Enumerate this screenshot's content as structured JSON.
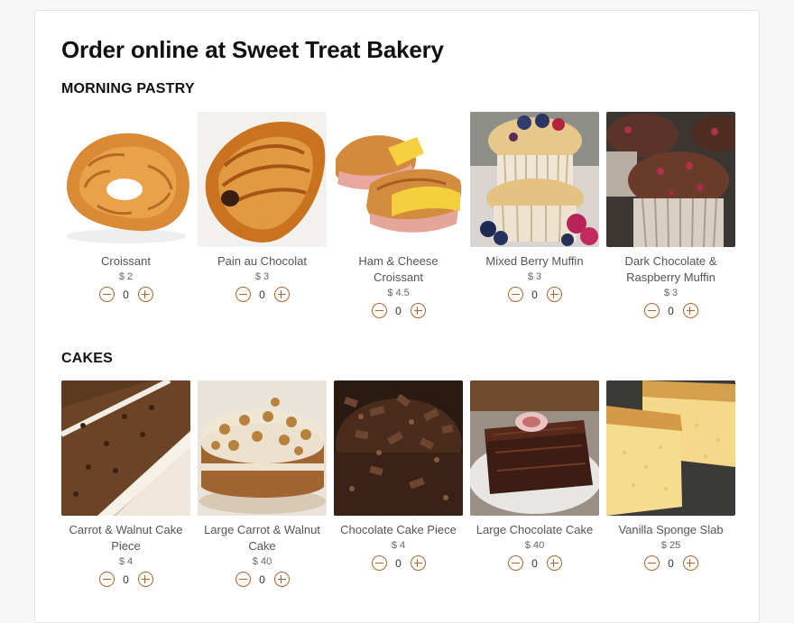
{
  "page": {
    "title": "Order online at Sweet Treat Bakery"
  },
  "colors": {
    "accent": "#b0642c",
    "card_background": "#ffffff",
    "page_background": "#f7f7f7"
  },
  "sections": [
    {
      "heading": "MORNING PASTRY",
      "items": [
        {
          "name": "Croissant",
          "price": "$ 2",
          "qty": "0",
          "image": "croissant-photo"
        },
        {
          "name": "Pain au Chocolat",
          "price": "$ 3",
          "qty": "0",
          "image": "pain-au-chocolat-photo"
        },
        {
          "name": "Ham & Cheese Croissant",
          "price": "$ 4.5",
          "qty": "0",
          "image": "ham-cheese-croissant-photo"
        },
        {
          "name": "Mixed Berry Muffin",
          "price": "$ 3",
          "qty": "0",
          "image": "berry-muffin-photo"
        },
        {
          "name": "Dark Chocolate & Raspberry Muffin",
          "price": "$ 3",
          "qty": "0",
          "image": "chocolate-muffin-photo"
        }
      ]
    },
    {
      "heading": "CAKES",
      "items": [
        {
          "name": "Carrot & Walnut Cake Piece",
          "price": "$ 4",
          "qty": "0",
          "image": "carrot-cake-slice-photo"
        },
        {
          "name": "Large Carrot & Walnut Cake",
          "price": "$ 40",
          "qty": "0",
          "image": "large-carrot-cake-photo"
        },
        {
          "name": "Chocolate Cake Piece",
          "price": "$ 4",
          "qty": "0",
          "image": "chocolate-cake-piece-photo"
        },
        {
          "name": "Large Chocolate Cake",
          "price": "$ 40",
          "qty": "0",
          "image": "large-chocolate-cake-photo"
        },
        {
          "name": "Vanilla Sponge Slab",
          "price": "$ 25",
          "qty": "0",
          "image": "vanilla-sponge-photo"
        }
      ]
    }
  ]
}
